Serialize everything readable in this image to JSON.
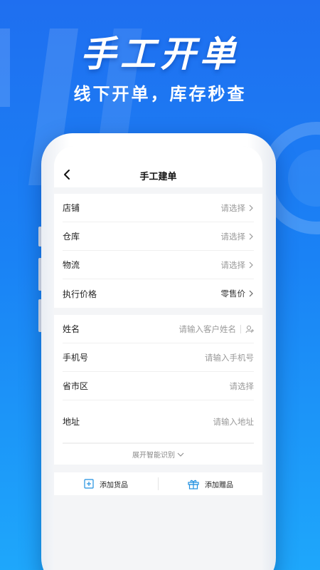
{
  "promo": {
    "title": "手工开单",
    "subtitle": "线下开单，库存秒查"
  },
  "nav": {
    "title": "手工建单"
  },
  "section1": {
    "rows": [
      {
        "label": "店铺",
        "value": "请选择"
      },
      {
        "label": "仓库",
        "value": "请选择"
      },
      {
        "label": "物流",
        "value": "请选择"
      },
      {
        "label": "执行价格",
        "value": "零售价"
      }
    ]
  },
  "section2": {
    "rows": [
      {
        "label": "姓名",
        "value": "请输入客户姓名"
      },
      {
        "label": "手机号",
        "value": "请输入手机号"
      },
      {
        "label": "省市区",
        "value": "请选择"
      },
      {
        "label": "地址",
        "value": "请输入地址"
      }
    ],
    "expand_label": "展开智能识别"
  },
  "bottom": {
    "add_goods": "添加货品",
    "add_gift": "添加赠品"
  },
  "colors": {
    "accent": "#1f8fe0",
    "bg_top": "#1f6ff0",
    "bg_bottom": "#1ea7fb"
  }
}
